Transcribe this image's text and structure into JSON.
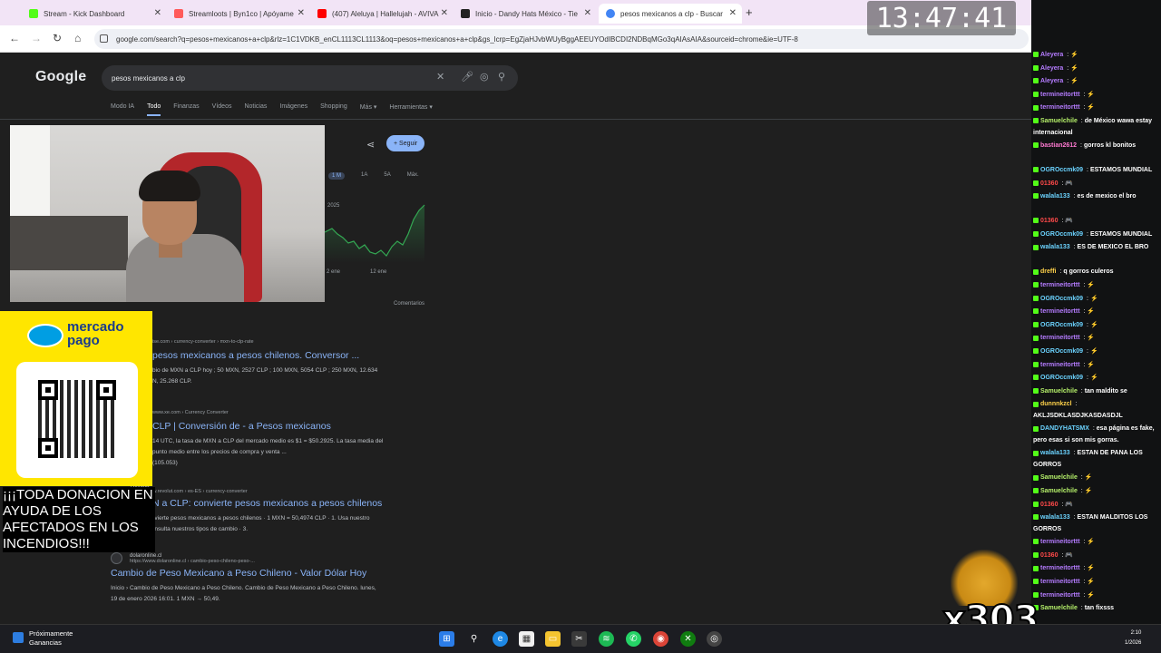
{
  "browser": {
    "tabs": [
      {
        "title": "Stream - Kick Dashboard",
        "color": "#53fc18"
      },
      {
        "title": "Streamloots | Byn1co | Apóyame",
        "color": "#ff5a5a"
      },
      {
        "title": "(407) Aleluya | Hallelujah - AVIVA",
        "color": "#ff0000"
      },
      {
        "title": "Inicio - Dandy Hats México - Tie",
        "color": "#222222"
      },
      {
        "title": "pesos mexicanos a clp - Buscar",
        "color": "#4285f4"
      }
    ],
    "url": "google.com/search?q=pesos+mexicanos+a+clp&rlz=1C1VDKB_enCL1113CL1113&oq=pesos+mexicanos+a+clp&gs_lcrp=EgZjaHJvbWUyBggAEEUYOdIBCDI2NDBqMGo3qAIAsAIA&sourceid=chrome&ie=UTF-8"
  },
  "google": {
    "logo": "Google",
    "query": "pesos mexicanos a clp",
    "tabs": [
      "Modo IA",
      "Todo",
      "Finanzas",
      "Vídeos",
      "Noticias",
      "Imágenes",
      "Shopping",
      "Más ▾",
      "Herramientas ▾"
    ],
    "follow_label": "+ Seguir",
    "ranges": [
      "1 M",
      "1A",
      "5A",
      "Máx."
    ],
    "chart_year": "2025",
    "chart_xlabels": [
      "2 ene",
      "12 ene"
    ],
    "comments": "Comentarios",
    "results": [
      {
        "url": "ise.com › currency-converter › mxn-to-clp-rate",
        "title": "pesos mexicanos a pesos chilenos. Conversor ...",
        "snippet": "bio de MXN a CLP hoy ; 50 MXN, 2527 CLP ; 100 MXN, 5054 CLP ; 250 MXN, 12.634\nN, 25.268 CLP."
      },
      {
        "url": "www.xe.com › Currency Converter",
        "title": "CLP | Conversión de - a Pesos mexicanos",
        "snippet": "14 UTC, la tasa de MXN a CLP del mercado medio es $1 = $50.2925. La tasa media del\npunto medio entre los precios de compra y venta ...\n(105.053)"
      },
      {
        "source": "Revolut",
        "url": "https://www.revolut.com › es-ES › currency-converter",
        "title": "N a CLP: convierte pesos mexicanos a pesos chilenos",
        "snippet": "MXN a CLP: convierte pesos mexicanos a pesos chilenos · 1 MXN = 50,4974 CLP · 1. Usa nuestro\n... divisas · 2. Consulta nuestros tipos de cambio · 3."
      },
      {
        "source": "dolaronline.cl",
        "url": "https://www.dolaronline.cl › cambio-peso-chileno-peso-...",
        "title": "Cambio de Peso Mexicano a Peso Chileno - Valor Dólar Hoy",
        "snippet": "Inicio › Cambio de Peso Mexicano a Peso Chileno. Cambio de Peso Mexicano a Peso Chileno. lunes,\n19 de enero 2026 16:01. 1 MXN → 50,49."
      }
    ]
  },
  "overlay": {
    "clock": "13:47:41",
    "mp_brand": "mercado\npago",
    "donation": "¡¡¡TODA DONACION EN AYUDA DE LOS AFECTADOS EN LOS INCENDIOS!!!",
    "alert_count": "x303"
  },
  "chat": {
    "messages": [
      {
        "user": "Aleyera",
        "text": "",
        "emote": "⚡",
        "color": "#b57cff"
      },
      {
        "user": "Aleyera",
        "text": "",
        "emote": "⚡",
        "color": "#b57cff"
      },
      {
        "user": "Aleyera",
        "text": "",
        "emote": "⚡",
        "color": "#b57cff"
      },
      {
        "user": "termineitorttt",
        "text": "",
        "emote": "⚡",
        "color": "#b57cff"
      },
      {
        "user": "termineitorttt",
        "text": "",
        "emote": "⚡",
        "color": "#b57cff"
      },
      {
        "user": "Samuelchile",
        "text": "de México wawa estay internacional",
        "emote": "",
        "color": "#b5f06a"
      },
      {
        "user": "bastian2612",
        "text": "gorros kl bonitos",
        "emote": "",
        "color": "#ff7ad1"
      },
      {
        "user": "OGROccmk09",
        "text": "ESTAMOS MUNDIAL",
        "emote": "",
        "color": "#6bd3ff"
      },
      {
        "user": "01360",
        "text": "",
        "emote": "🎮",
        "color": "#ff4a4a"
      },
      {
        "user": "walala133",
        "text": "es de mexico el bro",
        "emote": "",
        "color": "#6bd3ff"
      },
      {
        "user": "01360",
        "text": "",
        "emote": "🎮",
        "color": "#ff4a4a"
      },
      {
        "user": "OGROccmk09",
        "text": "ESTAMOS MUNDIAL",
        "emote": "",
        "color": "#6bd3ff"
      },
      {
        "user": "walala133",
        "text": "ES DE MEXICO EL BRO",
        "emote": "",
        "color": "#6bd3ff"
      },
      {
        "user": "dreffi",
        "text": "q gorros culeros",
        "emote": "",
        "color": "#ffd24a"
      },
      {
        "user": "termineitorttt",
        "text": "",
        "emote": "⚡",
        "color": "#b57cff"
      },
      {
        "user": "OGROccmk09",
        "text": "",
        "emote": "⚡",
        "color": "#6bd3ff"
      },
      {
        "user": "termineitorttt",
        "text": "",
        "emote": "⚡",
        "color": "#b57cff"
      },
      {
        "user": "OGROccmk09",
        "text": "",
        "emote": "⚡",
        "color": "#6bd3ff"
      },
      {
        "user": "termineitorttt",
        "text": "",
        "emote": "⚡",
        "color": "#b57cff"
      },
      {
        "user": "OGROccmk09",
        "text": "",
        "emote": "⚡",
        "color": "#6bd3ff"
      },
      {
        "user": "termineitorttt",
        "text": "",
        "emote": "⚡",
        "color": "#b57cff"
      },
      {
        "user": "OGROccmk09",
        "text": "",
        "emote": "⚡",
        "color": "#6bd3ff"
      },
      {
        "user": "Samuelchile",
        "text": "tan maldito se",
        "emote": "",
        "color": "#b5f06a"
      },
      {
        "user": "dunnnkzcl",
        "text": "AKLJSDKLASDJKASDASDJL",
        "emote": "",
        "color": "#ffd24a"
      },
      {
        "user": "DANDYHATSMX",
        "text": "esa página es fake, pero esas si son mis gorras.",
        "emote": "",
        "color": "#6bd3ff"
      },
      {
        "user": "walala133",
        "text": "ESTAN DE PANA LOS GORROS",
        "emote": "",
        "color": "#6bd3ff"
      },
      {
        "user": "Samuelchile",
        "text": "",
        "emote": "⚡",
        "color": "#b5f06a"
      },
      {
        "user": "Samuelchile",
        "text": "",
        "emote": "⚡",
        "color": "#b5f06a"
      },
      {
        "user": "01360",
        "text": "",
        "emote": "🎮",
        "color": "#ff4a4a"
      },
      {
        "user": "walala133",
        "text": "ESTAN MALDITOS LOS GORROS",
        "emote": "",
        "color": "#6bd3ff"
      },
      {
        "user": "termineitorttt",
        "text": "",
        "emote": "⚡",
        "color": "#b57cff"
      },
      {
        "user": "01360",
        "text": "",
        "emote": "🎮",
        "color": "#ff4a4a"
      },
      {
        "user": "termineitorttt",
        "text": "",
        "emote": "⚡",
        "color": "#b57cff"
      },
      {
        "user": "termineitorttt",
        "text": "",
        "emote": "⚡",
        "color": "#b57cff"
      },
      {
        "user": "termineitorttt",
        "text": "",
        "emote": "⚡",
        "color": "#b57cff"
      },
      {
        "user": "Samuelchile",
        "text": "tan fixsss",
        "emote": "",
        "color": "#b5f06a"
      }
    ]
  },
  "taskbar": {
    "weather_title": "Próximamente",
    "weather_sub": "Ganancias",
    "clock_time": "2:10",
    "clock_date": "1/2026"
  }
}
